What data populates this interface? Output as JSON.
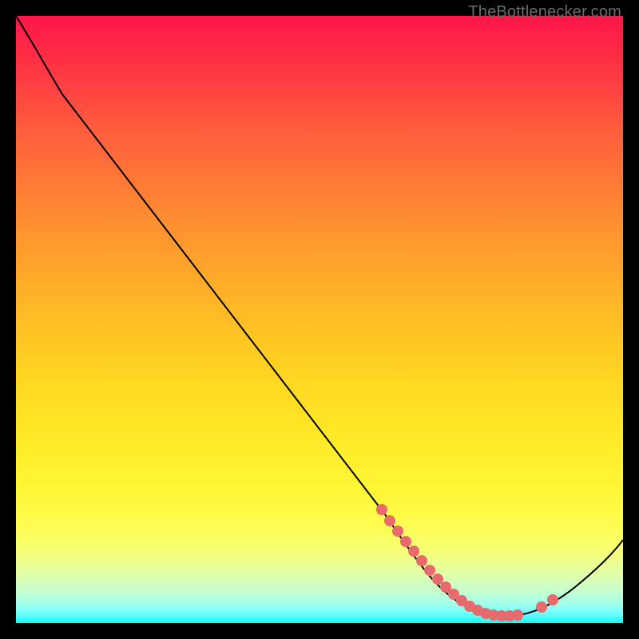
{
  "watermark_text": "TheBottlenecker.com",
  "chart_data": {
    "type": "line",
    "title": "",
    "xlabel": "",
    "ylabel": "",
    "xlim": [
      0,
      100
    ],
    "ylim": [
      0,
      100
    ],
    "x": [
      0,
      6,
      12,
      62,
      68,
      72,
      76,
      80,
      84,
      88,
      92,
      100
    ],
    "values": [
      100,
      92,
      86,
      18,
      12,
      8,
      5,
      3,
      2,
      2,
      4,
      14
    ],
    "series": [
      {
        "name": "curve",
        "x": [
          0,
          6,
          12,
          62,
          68,
          72,
          76,
          80,
          84,
          88,
          92,
          100
        ],
        "values": [
          100,
          92,
          86,
          18,
          12,
          8,
          5,
          3,
          2,
          2,
          4,
          14
        ]
      }
    ],
    "highlight_points": {
      "x": [
        60,
        62,
        63,
        65,
        66,
        67,
        69,
        70,
        71,
        73,
        74,
        75,
        76,
        77,
        78,
        80,
        81,
        82,
        86,
        88
      ],
      "y": [
        20,
        17,
        15,
        12,
        10,
        9,
        7,
        6,
        5,
        4,
        3.5,
        3,
        3,
        2.7,
        2.5,
        2.3,
        2.2,
        2.2,
        3,
        4
      ]
    },
    "colors": {
      "gradient_top": "#ff1648",
      "gradient_mid": "#ffe324",
      "gradient_bottom": "#0dfcf7",
      "curve": "#000000",
      "dots": "#e86a6d",
      "frame": "#000000"
    }
  }
}
